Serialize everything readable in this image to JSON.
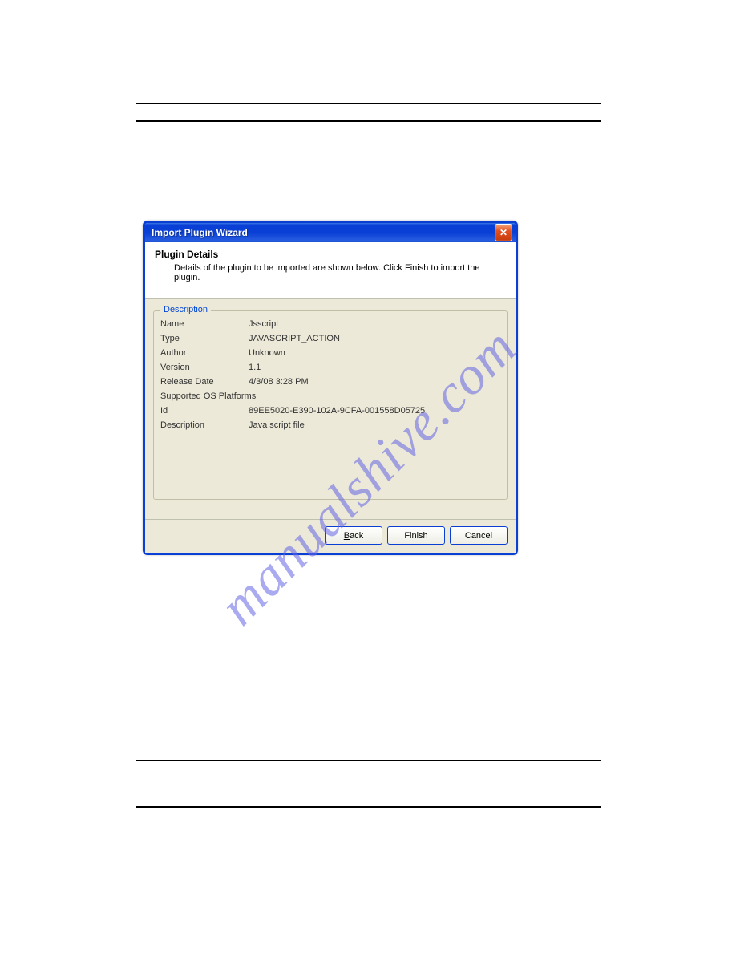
{
  "watermark": "manualshive.com",
  "dialog": {
    "title": "Import Plugin Wizard",
    "header": {
      "title": "Plugin Details",
      "subtitle": "Details of the plugin to be imported are shown below.  Click Finish to import the plugin."
    },
    "description": {
      "legend": "Description",
      "fields": {
        "name_label": "Name",
        "name_value": "Jsscript",
        "type_label": "Type",
        "type_value": "JAVASCRIPT_ACTION",
        "author_label": "Author",
        "author_value": "Unknown",
        "version_label": "Version",
        "version_value": "1.1",
        "release_label": "Release Date",
        "release_value": "4/3/08 3:28 PM",
        "platforms_label": "Supported OS Platforms",
        "platforms_value": "",
        "id_label": "Id",
        "id_value": "89EE5020-E390-102A-9CFA-001558D05725",
        "desc_label": "Description",
        "desc_value": "Java script file"
      }
    },
    "buttons": {
      "back": "Back",
      "finish": "Finish",
      "cancel": "Cancel"
    }
  }
}
